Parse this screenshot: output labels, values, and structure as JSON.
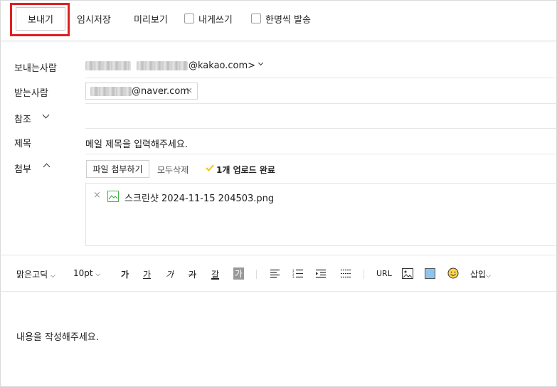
{
  "toolbar": {
    "send_label": "보내기",
    "draft_label": "임시저장",
    "preview_label": "미리보기",
    "to_self_label": "내게쓰기",
    "individual_label": "한명씩 발송"
  },
  "form": {
    "from_label": "보내는사람",
    "from_domain": "@kakao.com>",
    "to_label": "받는사람",
    "to_chip_domain": "@naver.com",
    "to_chip_remove": "×",
    "cc_label": "참조",
    "subject_label": "제목",
    "subject_placeholder": "메일 제목을 입력해주세요.",
    "attach_label": "첨부",
    "attach_button": "파일 첨부하기",
    "delete_all": "모두삭제",
    "upload_status": "1개 업로드 완료",
    "file_name": "스크린샷 2024-11-15 204503.png",
    "file_remove": "×"
  },
  "editor": {
    "font_family": "맑은고딕",
    "font_size": "10pt",
    "bold": "가",
    "underline": "가",
    "italic": "가",
    "strike": "가",
    "font_color": "갈",
    "bg_color": "가",
    "url": "URL",
    "insert": "삽입",
    "body_placeholder": "내용을 작성해주세요."
  },
  "colors": {
    "highlight": "#e02020",
    "upload_check": "#f0c419",
    "file_icon": "#4caf50",
    "table_icon": "#8ec5ef"
  }
}
